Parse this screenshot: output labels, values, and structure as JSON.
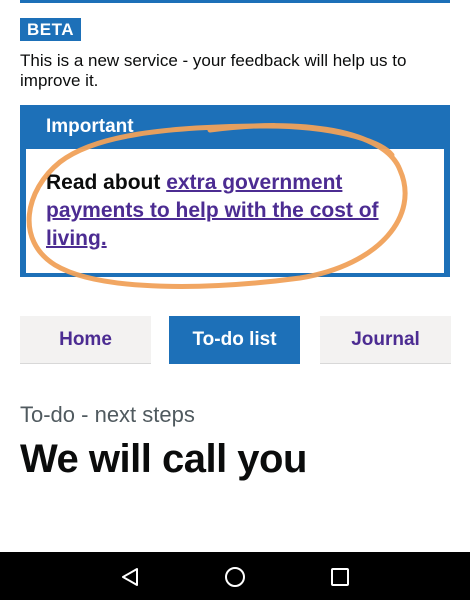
{
  "phase_banner": {
    "tag": "BETA",
    "text": "This is a new service - your feedback will help us to improve it."
  },
  "notification": {
    "title": "Important",
    "text_prefix": "Read about ",
    "link_text": "extra government payments to help with the cost of living."
  },
  "nav": {
    "tabs": [
      {
        "label": "Home",
        "active": false
      },
      {
        "label": "To-do list",
        "active": true
      },
      {
        "label": "Journal",
        "active": false
      }
    ]
  },
  "page": {
    "caption": "To-do - next steps",
    "heading": "We will call you"
  },
  "system_nav": {
    "icons": [
      "back-icon",
      "home-icon",
      "recents-icon"
    ]
  },
  "colors": {
    "brand_blue": "#1d70b8",
    "link_purple": "#4c2c92",
    "annotation_orange": "#f0a15a"
  }
}
